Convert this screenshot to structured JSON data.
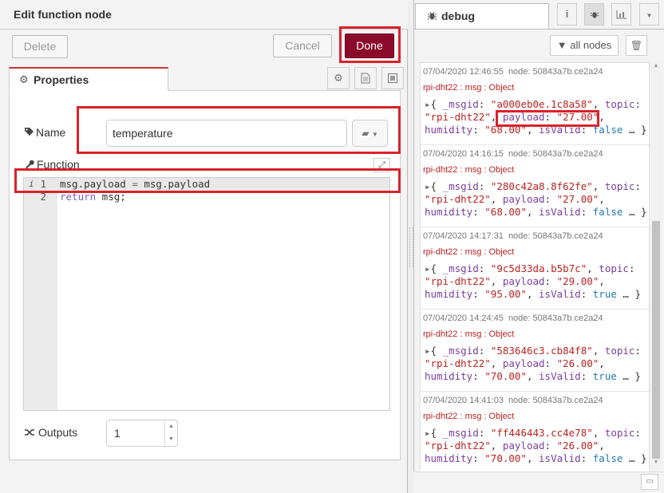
{
  "tray": {
    "title": "Edit function node",
    "delete_label": "Delete",
    "cancel_label": "Cancel",
    "done_label": "Done",
    "tab_properties": "Properties",
    "name_label": "Name",
    "name_value": "temperature",
    "function_label": "Function",
    "code_lines": [
      {
        "num": "1",
        "text": "msg.payload = msg.payload"
      },
      {
        "num": "2",
        "text": "return msg;"
      }
    ],
    "outputs_label": "Outputs",
    "outputs_value": "1"
  },
  "sidebar": {
    "tab_label": "debug",
    "filter_label": "all nodes",
    "messages": [
      {
        "time": "07/04/2020 12:46:55",
        "node": "node: 50843a7b.ce2a24",
        "source": "rpi-dht22 : msg : Object",
        "msgid": "\"a000eb0e.1c8a58\"",
        "topic": "\"rpi-dht22\"",
        "payload": "\"27.00\"",
        "humidity": "\"68.00\"",
        "isValid": "false"
      },
      {
        "time": "07/04/2020 14:16:15",
        "node": "node: 50843a7b.ce2a24",
        "source": "rpi-dht22 : msg : Object",
        "msgid": "\"280c42a8.8f62fe\"",
        "topic": "\"rpi-dht22\"",
        "payload": "\"27.00\"",
        "humidity": "\"68.00\"",
        "isValid": "false"
      },
      {
        "time": "07/04/2020 14:17:31",
        "node": "node: 50843a7b.ce2a24",
        "source": "rpi-dht22 : msg : Object",
        "msgid": "\"9c5d33da.b5b7c\"",
        "topic": "\"rpi-dht22\"",
        "payload": "\"29.00\"",
        "humidity": "\"95.00\"",
        "isValid": "true"
      },
      {
        "time": "07/04/2020 14:24:45",
        "node": "node: 50843a7b.ce2a24",
        "source": "rpi-dht22 : msg : Object",
        "msgid": "\"583646c3.cb84f8\"",
        "topic": "\"rpi-dht22\"",
        "payload": "\"26.00\"",
        "humidity": "\"70.00\"",
        "isValid": "true"
      },
      {
        "time": "07/04/2020 14:41:03",
        "node": "node: 50843a7b.ce2a24",
        "source": "rpi-dht22 : msg : Object",
        "msgid": "\"ff446443.cc4e78\"",
        "topic": "\"rpi-dht22\"",
        "payload": "\"26.00\"",
        "humidity": "\"70.00\"",
        "isValid": "false"
      }
    ]
  },
  "colors": {
    "done_button": "#8b0a2b",
    "highlight": "#d9222a",
    "string_value": "#bb2222",
    "key": "#7a3e9d"
  }
}
